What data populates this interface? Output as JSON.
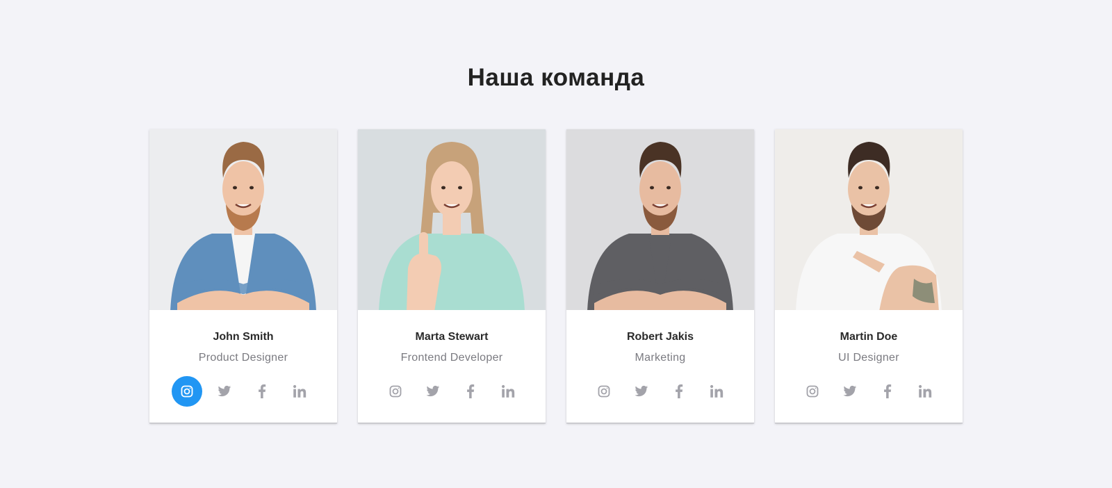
{
  "page": {
    "title": "Наша команда"
  },
  "accent_color": "#2196f3",
  "icon_color": "#a3a3aa",
  "social_icons": [
    "instagram-icon",
    "twitter-icon",
    "facebook-icon",
    "linkedin-icon"
  ],
  "team": [
    {
      "name": "John Smith",
      "role": "Product Designer",
      "photo": {
        "bg": "#ecedef",
        "shirt": "#5f8fbd",
        "under": "#f5f5f5",
        "hair": "#9a6a44",
        "beard": "#b77a4d",
        "skin": "#efc3a6",
        "arms": "crossed"
      },
      "active_social": "instagram-icon"
    },
    {
      "name": "Marta Stewart",
      "role": "Frontend Developer",
      "photo": {
        "bg": "#d8dde0",
        "shirt": "#a9ddd1",
        "under": "#a9ddd1",
        "hair": "#c7a27a",
        "beard": "",
        "skin": "#f3ccb3",
        "arms": "thumb"
      }
    },
    {
      "name": "Robert Jakis",
      "role": "Marketing",
      "photo": {
        "bg": "#dcdcde",
        "shirt": "#5f5f63",
        "under": "#5f5f63",
        "hair": "#4a3325",
        "beard": "#8a5a3d",
        "skin": "#e7bba0",
        "arms": "crossed"
      }
    },
    {
      "name": "Martin Doe",
      "role": "UI Designer",
      "photo": {
        "bg": "#efedea",
        "shirt": "#f7f7f7",
        "under": "#f7f7f7",
        "hair": "#3d2c24",
        "beard": "#6e4a36",
        "skin": "#eac2a6",
        "arms": "point"
      }
    }
  ]
}
